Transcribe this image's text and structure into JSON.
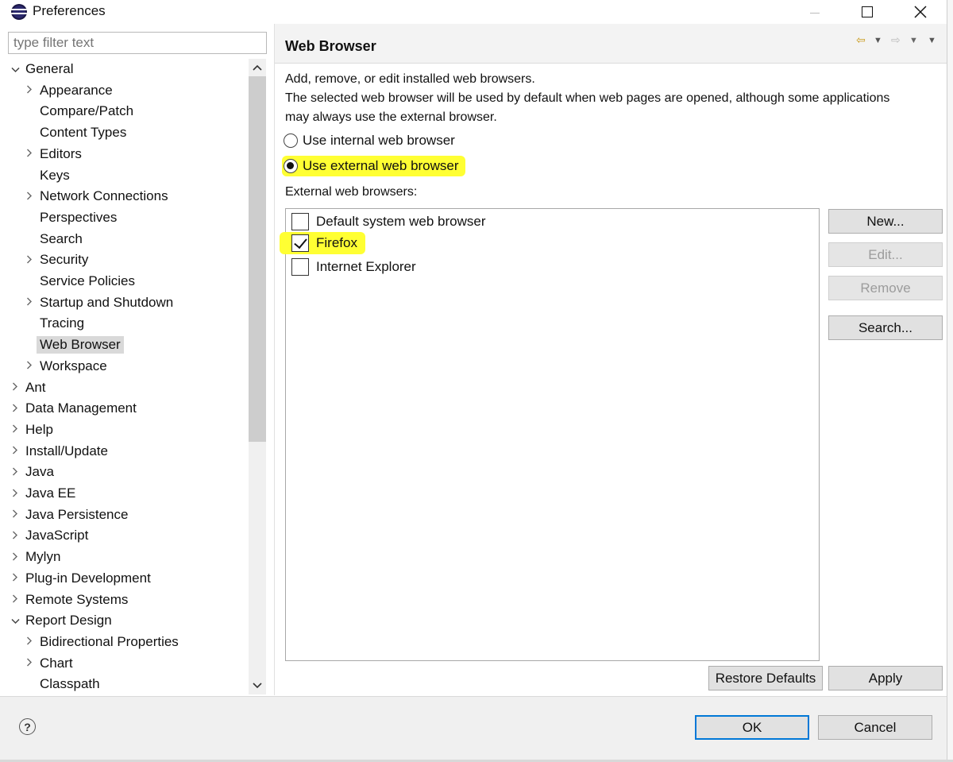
{
  "window": {
    "title": "Preferences"
  },
  "filter": {
    "placeholder": "type filter text"
  },
  "tree": [
    {
      "label": "General",
      "level": 0,
      "state": "expanded"
    },
    {
      "label": "Appearance",
      "level": 1,
      "state": "collapsed"
    },
    {
      "label": "Compare/Patch",
      "level": 1,
      "state": "leaf"
    },
    {
      "label": "Content Types",
      "level": 1,
      "state": "leaf"
    },
    {
      "label": "Editors",
      "level": 1,
      "state": "collapsed"
    },
    {
      "label": "Keys",
      "level": 1,
      "state": "leaf"
    },
    {
      "label": "Network Connections",
      "level": 1,
      "state": "collapsed"
    },
    {
      "label": "Perspectives",
      "level": 1,
      "state": "leaf"
    },
    {
      "label": "Search",
      "level": 1,
      "state": "leaf"
    },
    {
      "label": "Security",
      "level": 1,
      "state": "collapsed"
    },
    {
      "label": "Service Policies",
      "level": 1,
      "state": "leaf"
    },
    {
      "label": "Startup and Shutdown",
      "level": 1,
      "state": "collapsed"
    },
    {
      "label": "Tracing",
      "level": 1,
      "state": "leaf"
    },
    {
      "label": "Web Browser",
      "level": 1,
      "state": "leaf",
      "selected": true
    },
    {
      "label": "Workspace",
      "level": 1,
      "state": "collapsed"
    },
    {
      "label": "Ant",
      "level": 0,
      "state": "collapsed"
    },
    {
      "label": "Data Management",
      "level": 0,
      "state": "collapsed"
    },
    {
      "label": "Help",
      "level": 0,
      "state": "collapsed"
    },
    {
      "label": "Install/Update",
      "level": 0,
      "state": "collapsed"
    },
    {
      "label": "Java",
      "level": 0,
      "state": "collapsed"
    },
    {
      "label": "Java EE",
      "level": 0,
      "state": "collapsed"
    },
    {
      "label": "Java Persistence",
      "level": 0,
      "state": "collapsed"
    },
    {
      "label": "JavaScript",
      "level": 0,
      "state": "collapsed"
    },
    {
      "label": "Mylyn",
      "level": 0,
      "state": "collapsed"
    },
    {
      "label": "Plug-in Development",
      "level": 0,
      "state": "collapsed"
    },
    {
      "label": "Remote Systems",
      "level": 0,
      "state": "collapsed"
    },
    {
      "label": "Report Design",
      "level": 0,
      "state": "expanded"
    },
    {
      "label": "Bidirectional Properties",
      "level": 1,
      "state": "collapsed"
    },
    {
      "label": "Chart",
      "level": 1,
      "state": "collapsed"
    },
    {
      "label": "Classpath",
      "level": 1,
      "state": "leaf"
    }
  ],
  "page": {
    "title": "Web Browser",
    "description_line1": "Add, remove, or edit installed web browsers.",
    "description_line2": "The selected web browser will be used by default when web pages are opened, although some applications",
    "description_line3": "may always use the external browser.",
    "radio_internal": "Use internal web browser",
    "radio_external": "Use external web browser",
    "selected_mode": "external",
    "list_label": "External web browsers:",
    "browsers": [
      {
        "label": "Default system web browser",
        "checked": false
      },
      {
        "label": "Firefox",
        "checked": true
      },
      {
        "label": "Internet Explorer",
        "checked": false
      }
    ],
    "buttons": {
      "new": "New...",
      "edit": "Edit...",
      "remove": "Remove",
      "search": "Search...",
      "restore_defaults": "Restore Defaults",
      "apply": "Apply"
    }
  },
  "footer": {
    "help": "?",
    "ok": "OK",
    "cancel": "Cancel"
  },
  "colors": {
    "highlight": "#ffff33",
    "focus_border": "#0078d7",
    "selection": "#d9d9d9"
  }
}
